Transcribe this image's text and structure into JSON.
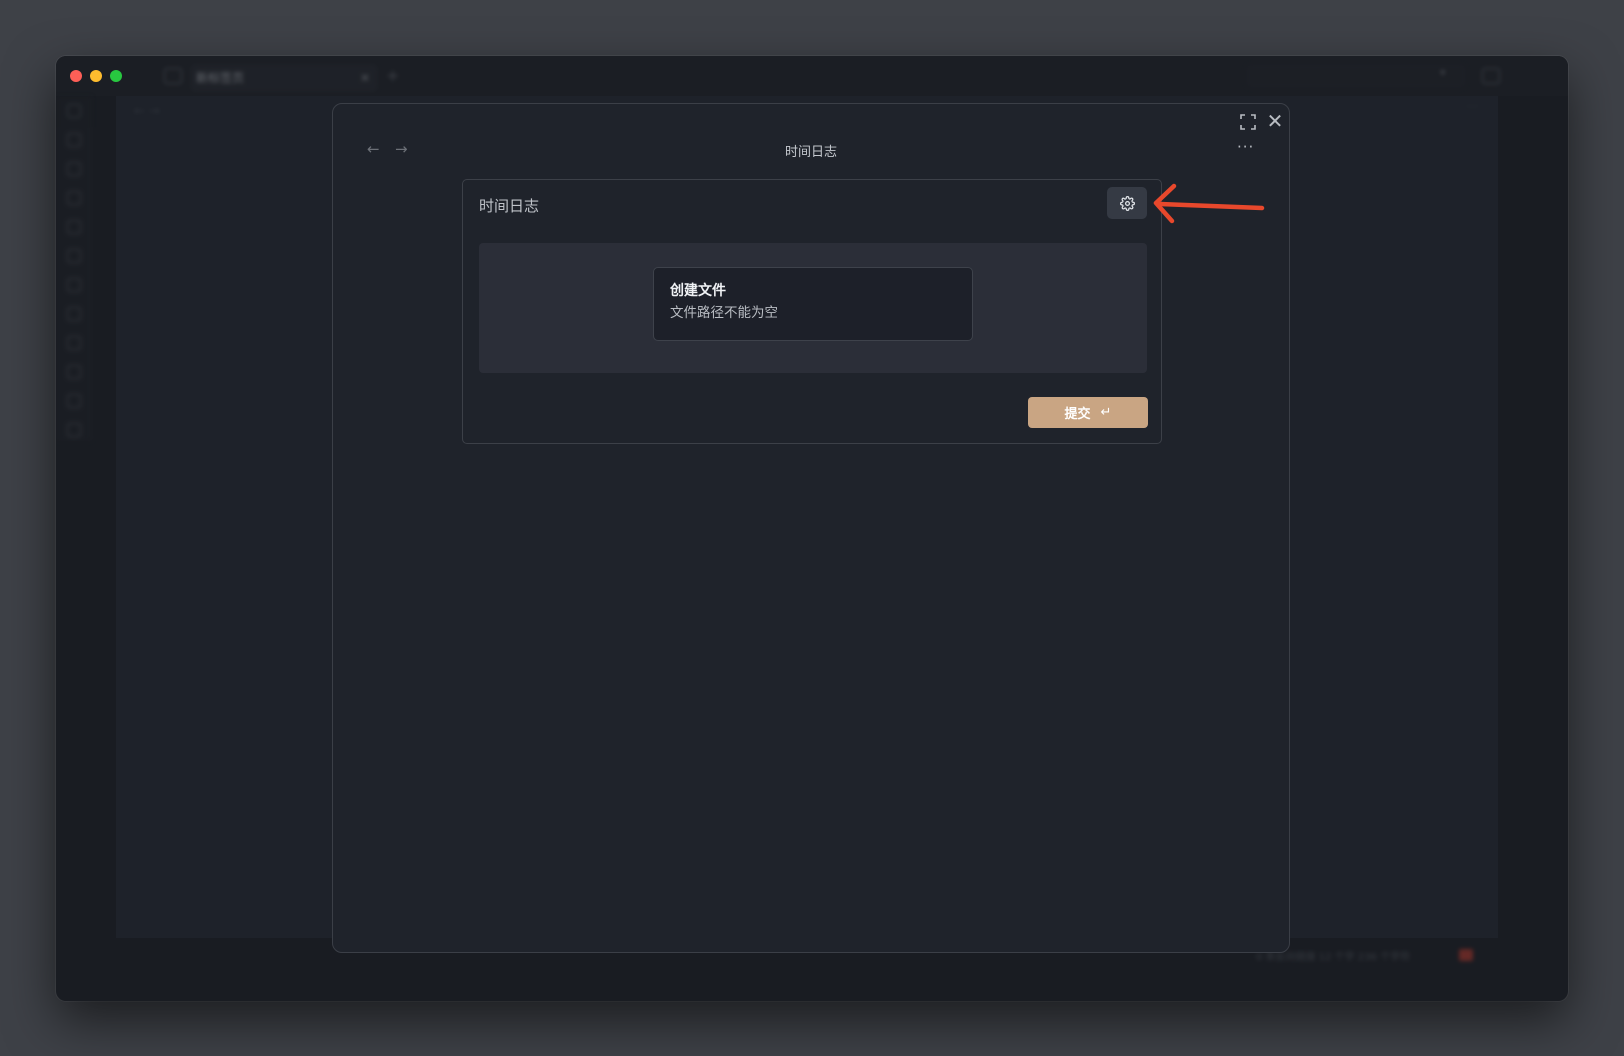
{
  "window": {
    "tab_label": "新标签页",
    "tab_close": "✕",
    "tab_add": "+",
    "statusbar_text": "0 条反向链接  12 个字  236 个字符"
  },
  "modal": {
    "title": "时间日志",
    "nav_back": "←",
    "nav_forward": "→",
    "more": "···",
    "expand_icon": "⛶",
    "close_icon": "✕"
  },
  "panel": {
    "title": "时间日志",
    "settings_icon": "gear-icon",
    "notice": {
      "title": "创建文件",
      "message": "文件路径不能为空"
    },
    "submit": {
      "label": "提交",
      "enter_symbol": "↵"
    }
  },
  "colors": {
    "accent_submit": "#c9a583",
    "annotation_arrow": "#e8482c",
    "modal_bg": "#1f232b"
  }
}
